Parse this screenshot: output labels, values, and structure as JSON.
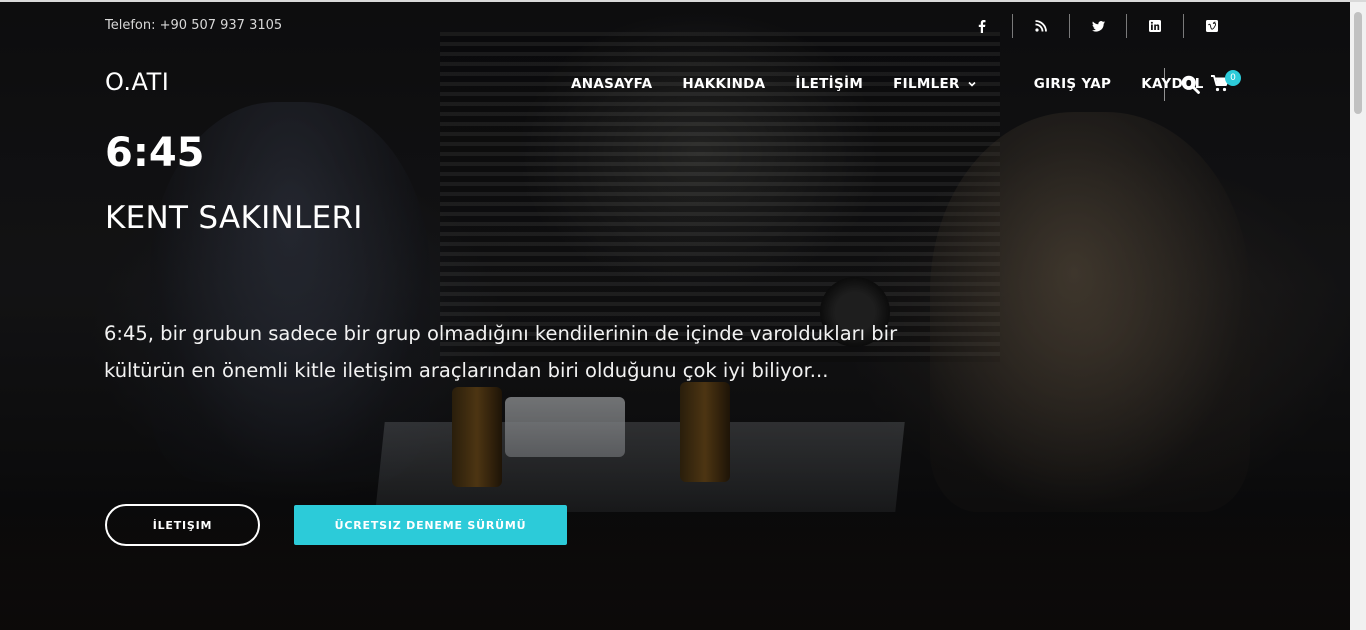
{
  "topbar": {
    "phone": "Telefon: +90 507 937 3105",
    "social": [
      {
        "icon": "facebook-icon"
      },
      {
        "icon": "rss-icon"
      },
      {
        "icon": "twitter-icon"
      },
      {
        "icon": "linkedin-icon"
      },
      {
        "icon": "vimeo-icon"
      }
    ]
  },
  "header": {
    "logo": "O.ATI",
    "nav": [
      "ANASAYFA",
      "HAKKINDA",
      "İLETİŞİM",
      "FILMLER"
    ],
    "login": "GIRIŞ YAP",
    "register": "KAYDOL",
    "cart_count": "0"
  },
  "hero": {
    "time": "6:45",
    "title": "KENT SAKINLERI",
    "description": "6:45, bir grubun sadece bir grup olmadığını kendilerinin de içinde varoldukları bir kültürün en önemli kitle iletişim araçlarından biri olduğunu çok iyi biliyor...",
    "button_contact": "İLETIŞIM",
    "button_trial": "ÜCRETSIZ DENEME SÜRÜMÜ"
  },
  "colors": {
    "accent": "#2ccbd9"
  }
}
